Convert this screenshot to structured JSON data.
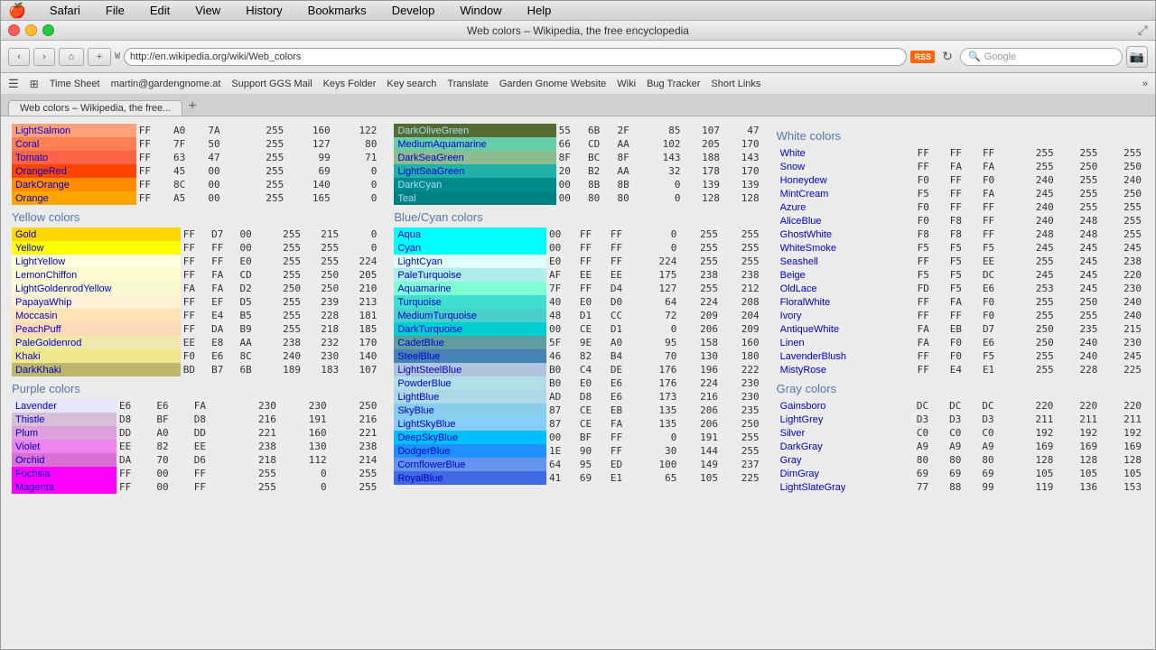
{
  "window": {
    "title": "Web colors – Wikipedia, the free encyclopedia"
  },
  "menubar": {
    "apple": "🍎",
    "items": [
      "Safari",
      "File",
      "Edit",
      "View",
      "History",
      "Bookmarks",
      "Develop",
      "Window",
      "Help"
    ]
  },
  "toolbar": {
    "back": "‹",
    "forward": "›",
    "home": "⌂",
    "add": "+",
    "url": "http://en.wikipedia.org/wiki/Web_colors",
    "rss": "RSS",
    "search_placeholder": "Google"
  },
  "bookmarks": [
    "Time Sheet",
    "martin@gardengnome.at",
    "Support GGS Mail",
    "Keys Folder",
    "Key search",
    "Translate",
    "Garden Gnome Website",
    "Wiki",
    "Bug Tracker",
    "Short Links"
  ],
  "tab": {
    "label": "Web colors – Wikipedia, the free..."
  },
  "sections": {
    "pink": {
      "title": "",
      "colors": [
        {
          "name": "LightSalmon",
          "h1": "FF",
          "h2": "A0",
          "h3": "7A",
          "r": "255",
          "g": "160",
          "b": "122",
          "bg": "#FFA07A",
          "dark": false
        },
        {
          "name": "Coral",
          "h1": "FF",
          "h2": "7F",
          "h3": "50",
          "r": "255",
          "g": "127",
          "b": "80",
          "bg": "#FF7F50",
          "dark": false
        },
        {
          "name": "Tomato",
          "h1": "FF",
          "h2": "63",
          "h3": "47",
          "r": "255",
          "g": "99",
          "b": "71",
          "bg": "#FF6347",
          "dark": false
        },
        {
          "name": "OrangeRed",
          "h1": "FF",
          "h2": "45",
          "h3": "00",
          "r": "255",
          "g": "69",
          "b": "0",
          "bg": "#FF4500",
          "dark": false
        },
        {
          "name": "DarkOrange",
          "h1": "FF",
          "h2": "8C",
          "h3": "00",
          "r": "255",
          "g": "140",
          "b": "0",
          "bg": "#FF8C00",
          "dark": false
        },
        {
          "name": "Orange",
          "h1": "FF",
          "h2": "A5",
          "h3": "00",
          "r": "255",
          "g": "165",
          "b": "0",
          "bg": "#FFA500",
          "dark": false
        }
      ]
    },
    "yellow": {
      "title": "Yellow colors",
      "colors": [
        {
          "name": "Gold",
          "h1": "FF",
          "h2": "D7",
          "h3": "00",
          "r": "255",
          "g": "215",
          "b": "0",
          "bg": "#FFD700",
          "dark": false
        },
        {
          "name": "Yellow",
          "h1": "FF",
          "h2": "FF",
          "h3": "00",
          "r": "255",
          "g": "255",
          "b": "0",
          "bg": "#FFFF00",
          "dark": false
        },
        {
          "name": "LightYellow",
          "h1": "FF",
          "h2": "FF",
          "h3": "E0",
          "r": "255",
          "g": "255",
          "b": "224",
          "bg": "#FFFFE0",
          "dark": false
        },
        {
          "name": "LemonChiffon",
          "h1": "FF",
          "h2": "FA",
          "h3": "CD",
          "r": "255",
          "g": "250",
          "b": "205",
          "bg": "#FFFACD",
          "dark": false
        },
        {
          "name": "LightGoldenrodYellow",
          "h1": "FA",
          "h2": "FA",
          "h3": "D2",
          "r": "250",
          "g": "250",
          "b": "210",
          "bg": "#FAFAD2",
          "dark": false
        },
        {
          "name": "PapayaWhip",
          "h1": "FF",
          "h2": "EF",
          "h3": "D5",
          "r": "255",
          "g": "239",
          "b": "213",
          "bg": "#FFEFD5",
          "dark": false
        },
        {
          "name": "Moccasin",
          "h1": "FF",
          "h2": "E4",
          "h3": "B5",
          "r": "255",
          "g": "228",
          "b": "181",
          "bg": "#FFE4B5",
          "dark": false
        },
        {
          "name": "PeachPuff",
          "h1": "FF",
          "h2": "DA",
          "h3": "B9",
          "r": "255",
          "g": "218",
          "b": "185",
          "bg": "#FFDAB9",
          "dark": false
        },
        {
          "name": "PaleGoldenrod",
          "h1": "EE",
          "h2": "E8",
          "h3": "AA",
          "r": "238",
          "g": "232",
          "b": "170",
          "bg": "#EEE8AA",
          "dark": false
        },
        {
          "name": "Khaki",
          "h1": "F0",
          "h2": "E6",
          "h3": "8C",
          "r": "240",
          "g": "230",
          "b": "140",
          "bg": "#F0E68C",
          "dark": false
        },
        {
          "name": "DarkKhaki",
          "h1": "BD",
          "h2": "B7",
          "h3": "6B",
          "r": "189",
          "g": "183",
          "b": "107",
          "bg": "#BDB76B",
          "dark": false
        }
      ]
    },
    "purple": {
      "title": "Purple colors",
      "colors": [
        {
          "name": "Lavender",
          "h1": "E6",
          "h2": "E6",
          "h3": "FA",
          "r": "230",
          "g": "230",
          "b": "250",
          "bg": "#E6E6FA",
          "dark": false
        },
        {
          "name": "Thistle",
          "h1": "D8",
          "h2": "BF",
          "h3": "D8",
          "r": "216",
          "g": "191",
          "b": "216",
          "bg": "#D8BFD8",
          "dark": false
        },
        {
          "name": "Plum",
          "h1": "DD",
          "h2": "A0",
          "h3": "DD",
          "r": "221",
          "g": "160",
          "b": "221",
          "bg": "#DDA0DD",
          "dark": false
        },
        {
          "name": "Violet",
          "h1": "EE",
          "h2": "82",
          "h3": "EE",
          "r": "238",
          "g": "130",
          "b": "238",
          "bg": "#EE82EE",
          "dark": false
        },
        {
          "name": "Orchid",
          "h1": "DA",
          "h2": "70",
          "h3": "D6",
          "r": "218",
          "g": "112",
          "b": "214",
          "bg": "#DA70D6",
          "dark": false
        },
        {
          "name": "Fuchsia",
          "h1": "FF",
          "h2": "00",
          "h3": "FF",
          "r": "255",
          "g": "0",
          "b": "255",
          "bg": "#FF00FF",
          "dark": false
        },
        {
          "name": "Magenta",
          "h1": "FF",
          "h2": "00",
          "h3": "FF",
          "r": "255",
          "g": "0",
          "b": "255",
          "bg": "#FF00FF",
          "dark": false
        }
      ]
    },
    "green": {
      "title": "",
      "colors": [
        {
          "name": "DarkOliveGreen",
          "h1": "55",
          "h2": "6B",
          "h3": "2F",
          "r": "85",
          "g": "107",
          "b": "47",
          "bg": "#556B2F",
          "dark": true
        },
        {
          "name": "MediumAquamarine",
          "h1": "66",
          "h2": "CD",
          "h3": "AA",
          "r": "102",
          "g": "205",
          "b": "170",
          "bg": "#66CDAA",
          "dark": false
        },
        {
          "name": "DarkSeaGreen",
          "h1": "8F",
          "h2": "BC",
          "h3": "8F",
          "r": "143",
          "g": "188",
          "b": "143",
          "bg": "#8FBC8F",
          "dark": false
        },
        {
          "name": "LightSeaGreen",
          "h1": "20",
          "h2": "B2",
          "h3": "AA",
          "r": "32",
          "g": "178",
          "b": "170",
          "bg": "#20B2AA",
          "dark": false
        },
        {
          "name": "DarkCyan",
          "h1": "00",
          "h2": "8B",
          "h3": "8B",
          "r": "0",
          "g": "139",
          "b": "139",
          "bg": "#008B8B",
          "dark": true
        },
        {
          "name": "Teal",
          "h1": "00",
          "h2": "80",
          "h3": "80",
          "r": "0",
          "g": "128",
          "b": "128",
          "bg": "#008080",
          "dark": true
        }
      ]
    },
    "blue_cyan": {
      "title": "Blue/Cyan colors",
      "colors": [
        {
          "name": "Aqua",
          "h1": "00",
          "h2": "FF",
          "h3": "FF",
          "r": "0",
          "g": "255",
          "b": "255",
          "bg": "#00FFFF",
          "dark": false
        },
        {
          "name": "Cyan",
          "h1": "00",
          "h2": "FF",
          "h3": "FF",
          "r": "0",
          "g": "255",
          "b": "255",
          "bg": "#00FFFF",
          "dark": false
        },
        {
          "name": "LightCyan",
          "h1": "E0",
          "h2": "FF",
          "h3": "FF",
          "r": "224",
          "g": "255",
          "b": "255",
          "bg": "#E0FFFF",
          "dark": false
        },
        {
          "name": "PaleTurquoise",
          "h1": "AF",
          "h2": "EE",
          "h3": "EE",
          "r": "175",
          "g": "238",
          "b": "238",
          "bg": "#AFEEEE",
          "dark": false
        },
        {
          "name": "Aquamarine",
          "h1": "7F",
          "h2": "FF",
          "h3": "D4",
          "r": "127",
          "g": "255",
          "b": "212",
          "bg": "#7FFFD4",
          "dark": false
        },
        {
          "name": "Turquoise",
          "h1": "40",
          "h2": "E0",
          "h3": "D0",
          "r": "64",
          "g": "224",
          "b": "208",
          "bg": "#40E0D0",
          "dark": false
        },
        {
          "name": "MediumTurquoise",
          "h1": "48",
          "h2": "D1",
          "h3": "CC",
          "r": "72",
          "g": "209",
          "b": "204",
          "bg": "#48D1CC",
          "dark": false
        },
        {
          "name": "DarkTurquoise",
          "h1": "00",
          "h2": "CE",
          "h3": "D1",
          "r": "0",
          "g": "206",
          "b": "209",
          "bg": "#00CED1",
          "dark": false
        },
        {
          "name": "CadetBlue",
          "h1": "5F",
          "h2": "9E",
          "h3": "A0",
          "r": "95",
          "g": "158",
          "b": "160",
          "bg": "#5F9EA0",
          "dark": false
        },
        {
          "name": "SteelBlue",
          "h1": "46",
          "h2": "82",
          "h3": "B4",
          "r": "70",
          "g": "130",
          "b": "180",
          "bg": "#4682B4",
          "dark": false
        },
        {
          "name": "LightSteelBlue",
          "h1": "B0",
          "h2": "C4",
          "h3": "DE",
          "r": "176",
          "g": "196",
          "b": "222",
          "bg": "#B0C4DE",
          "dark": false
        },
        {
          "name": "PowderBlue",
          "h1": "B0",
          "h2": "E0",
          "h3": "E6",
          "r": "176",
          "g": "224",
          "b": "230",
          "bg": "#B0E0E6",
          "dark": false
        },
        {
          "name": "LightBlue",
          "h1": "AD",
          "h2": "D8",
          "h3": "E6",
          "r": "173",
          "g": "216",
          "b": "230",
          "bg": "#ADD8E6",
          "dark": false
        },
        {
          "name": "SkyBlue",
          "h1": "87",
          "h2": "CE",
          "h3": "EB",
          "r": "135",
          "g": "206",
          "b": "235",
          "bg": "#87CEEB",
          "dark": false
        },
        {
          "name": "LightSkyBlue",
          "h1": "87",
          "h2": "CE",
          "h3": "FA",
          "r": "135",
          "g": "206",
          "b": "250",
          "bg": "#87CEFA",
          "dark": false
        },
        {
          "name": "DeepSkyBlue",
          "h1": "00",
          "h2": "BF",
          "h3": "FF",
          "r": "0",
          "g": "191",
          "b": "255",
          "bg": "#00BFFF",
          "dark": false
        },
        {
          "name": "DodgerBlue",
          "h1": "1E",
          "h2": "90",
          "h3": "FF",
          "r": "30",
          "g": "144",
          "b": "255",
          "bg": "#1E90FF",
          "dark": false
        },
        {
          "name": "CornflowerBlue",
          "h1": "64",
          "h2": "95",
          "h3": "ED",
          "r": "100",
          "g": "149",
          "b": "237",
          "bg": "#6495ED",
          "dark": false
        },
        {
          "name": "RoyalBlue",
          "h1": "41",
          "h2": "69",
          "h3": "E1",
          "r": "65",
          "g": "105",
          "b": "225",
          "bg": "#4169E1",
          "dark": false
        }
      ]
    },
    "white": {
      "title": "White colors",
      "colors": [
        {
          "name": "White",
          "h1": "FF",
          "h2": "FF",
          "h3": "FF",
          "r": "255",
          "g": "255",
          "b": "255",
          "bg": "#FFFFFF"
        },
        {
          "name": "Snow",
          "h1": "FF",
          "h2": "FA",
          "h3": "FA",
          "r": "255",
          "g": "250",
          "b": "250",
          "bg": "#FFFAFA"
        },
        {
          "name": "Honeydew",
          "h1": "F0",
          "h2": "FF",
          "h3": "F0",
          "r": "240",
          "g": "255",
          "b": "240",
          "bg": "#F0FFF0"
        },
        {
          "name": "MintCream",
          "h1": "F5",
          "h2": "FF",
          "h3": "FA",
          "r": "245",
          "g": "255",
          "b": "250",
          "bg": "#F5FFFA"
        },
        {
          "name": "Azure",
          "h1": "F0",
          "h2": "FF",
          "h3": "FF",
          "r": "240",
          "g": "255",
          "b": "255",
          "bg": "#F0FFFF"
        },
        {
          "name": "AliceBlue",
          "h1": "F0",
          "h2": "F8",
          "h3": "FF",
          "r": "240",
          "g": "248",
          "b": "255",
          "bg": "#F0F8FF"
        },
        {
          "name": "GhostWhite",
          "h1": "F8",
          "h2": "F8",
          "h3": "FF",
          "r": "248",
          "g": "248",
          "b": "255",
          "bg": "#F8F8FF"
        },
        {
          "name": "WhiteSmoke",
          "h1": "F5",
          "h2": "F5",
          "h3": "F5",
          "r": "245",
          "g": "245",
          "b": "245",
          "bg": "#F5F5F5"
        },
        {
          "name": "Seashell",
          "h1": "FF",
          "h2": "F5",
          "h3": "EE",
          "r": "255",
          "g": "245",
          "b": "238",
          "bg": "#FFF5EE"
        },
        {
          "name": "Beige",
          "h1": "F5",
          "h2": "F5",
          "h3": "DC",
          "r": "245",
          "g": "245",
          "b": "220",
          "bg": "#F5F5DC"
        },
        {
          "name": "OldLace",
          "h1": "FD",
          "h2": "F5",
          "h3": "E6",
          "r": "253",
          "g": "245",
          "b": "230",
          "bg": "#FDF5E6"
        },
        {
          "name": "FloralWhite",
          "h1": "FF",
          "h2": "FA",
          "h3": "F0",
          "r": "255",
          "g": "250",
          "b": "240",
          "bg": "#FFFAF0"
        },
        {
          "name": "Ivory",
          "h1": "FF",
          "h2": "FF",
          "h3": "F0",
          "r": "255",
          "g": "255",
          "b": "240",
          "bg": "#FFFFF0"
        },
        {
          "name": "AntiqueWhite",
          "h1": "FA",
          "h2": "EB",
          "h3": "D7",
          "r": "250",
          "g": "235",
          "b": "215",
          "bg": "#FAEBD7"
        },
        {
          "name": "Linen",
          "h1": "FA",
          "h2": "F0",
          "h3": "E6",
          "r": "250",
          "g": "240",
          "b": "230",
          "bg": "#FAF0E6"
        },
        {
          "name": "LavenderBlush",
          "h1": "FF",
          "h2": "F0",
          "h3": "F5",
          "r": "255",
          "g": "240",
          "b": "245",
          "bg": "#FFF0F5"
        },
        {
          "name": "MistyRose",
          "h1": "FF",
          "h2": "E4",
          "h3": "E1",
          "r": "255",
          "g": "228",
          "b": "225",
          "bg": "#FFE4E1"
        }
      ]
    },
    "gray": {
      "title": "Gray colors",
      "colors": [
        {
          "name": "Gainsboro",
          "h1": "DC",
          "h2": "DC",
          "h3": "DC",
          "r": "220",
          "g": "220",
          "b": "220",
          "bg": "#DCDCDC"
        },
        {
          "name": "LightGrey",
          "h1": "D3",
          "h2": "D3",
          "h3": "D3",
          "r": "211",
          "g": "211",
          "b": "211",
          "bg": "#D3D3D3"
        },
        {
          "name": "Silver",
          "h1": "C0",
          "h2": "C0",
          "h3": "C0",
          "r": "192",
          "g": "192",
          "b": "192",
          "bg": "#C0C0C0"
        },
        {
          "name": "DarkGray",
          "h1": "A9",
          "h2": "A9",
          "h3": "A9",
          "r": "169",
          "g": "169",
          "b": "169",
          "bg": "#A9A9A9"
        },
        {
          "name": "Gray",
          "h1": "80",
          "h2": "80",
          "h3": "80",
          "r": "128",
          "g": "128",
          "b": "128",
          "bg": "#808080"
        },
        {
          "name": "DimGray",
          "h1": "69",
          "h2": "69",
          "h3": "69",
          "r": "105",
          "g": "105",
          "b": "105",
          "bg": "#696969"
        },
        {
          "name": "LightSlateGray",
          "h1": "77",
          "h2": "88",
          "h3": "99",
          "r": "119",
          "g": "136",
          "b": "153",
          "bg": "#778899"
        }
      ]
    }
  }
}
